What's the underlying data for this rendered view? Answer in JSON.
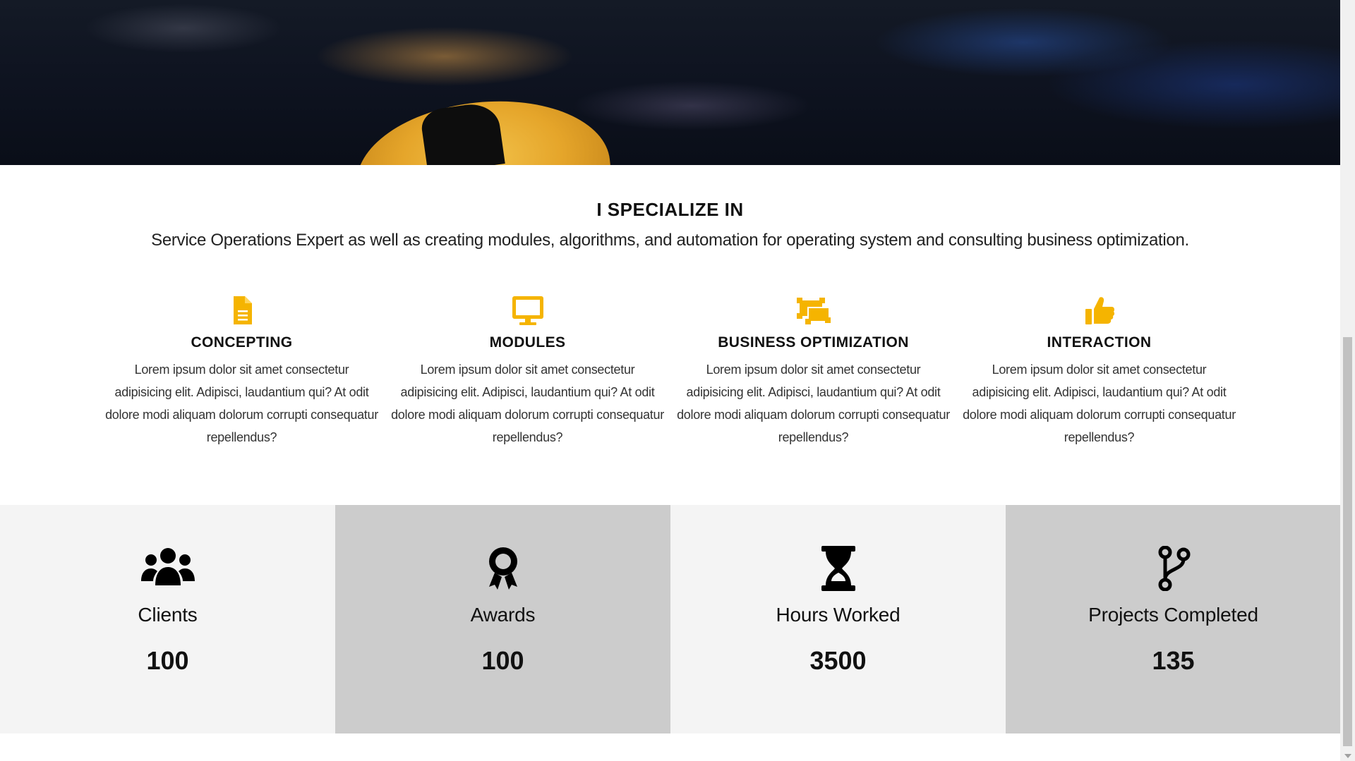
{
  "colors": {
    "accent": "#f5b400",
    "stat_light": "#f4f4f4",
    "stat_dark": "#cccccc",
    "text": "#111111"
  },
  "specialize": {
    "title": "I SPECIALIZE IN",
    "subtitle": "Service Operations Expert as well as creating modules, algorithms, and automation for operating system and consulting business optimization."
  },
  "features": [
    {
      "icon": "document-icon",
      "title": "CONCEPTING",
      "text": "Lorem ipsum dolor sit amet consectetur adipisicing elit. Adipisci, laudantium qui? At odit dolore modi aliquam dolorum corrupti consequatur repellendus?"
    },
    {
      "icon": "monitor-icon",
      "title": "MODULES",
      "text": "Lorem ipsum dolor sit amet consectetur adipisicing elit. Adipisci, laudantium qui? At odit dolore modi aliquam dolorum corrupti consequatur repellendus?"
    },
    {
      "icon": "object-group-icon",
      "title": "BUSINESS OPTIMIZATION",
      "text": "Lorem ipsum dolor sit amet consectetur adipisicing elit. Adipisci, laudantium qui? At odit dolore modi aliquam dolorum corrupti consequatur repellendus?"
    },
    {
      "icon": "thumbs-up-icon",
      "title": "INTERACTION",
      "text": "Lorem ipsum dolor sit amet consectetur adipisicing elit. Adipisci, laudantium qui? At odit dolore modi aliquam dolorum corrupti consequatur repellendus?"
    }
  ],
  "stats": [
    {
      "icon": "users-icon",
      "label": "Clients",
      "value": "100"
    },
    {
      "icon": "award-icon",
      "label": "Awards",
      "value": "100"
    },
    {
      "icon": "hourglass-icon",
      "label": "Hours Worked",
      "value": "3500"
    },
    {
      "icon": "code-branch-icon",
      "label": "Projects Completed",
      "value": "135"
    }
  ]
}
